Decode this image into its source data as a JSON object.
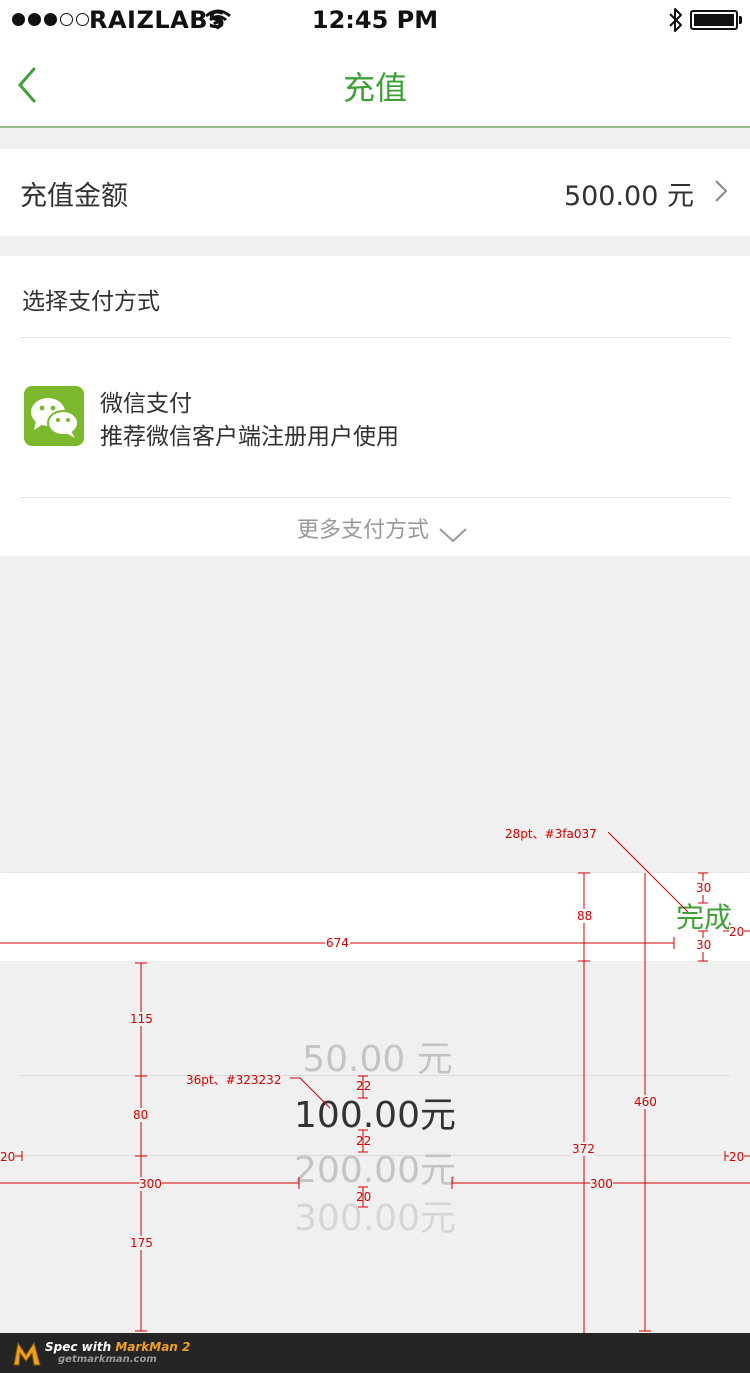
{
  "status_bar": {
    "carrier": "RAIZLABS",
    "time": "12:45 PM"
  },
  "nav": {
    "title": "充值"
  },
  "amount_row": {
    "label": "充值金额",
    "value": "500.00 元"
  },
  "payment": {
    "section_title": "选择支付方式",
    "method_name": "微信支付",
    "method_desc": "推荐微信客户端注册用户使用",
    "more_label": "更多支付方式"
  },
  "picker": {
    "done_label": "完成",
    "options": [
      "50.00 元",
      "100.00元",
      "200.00元",
      "300.00元"
    ],
    "selected": "100.00元"
  },
  "spec_annotations": {
    "done_font": "28pt、#3fa037",
    "option_font": "36pt、#323232",
    "m_toolbar_width": "674",
    "m_toolbar_height": "88",
    "m_done_top": "30",
    "m_done_bottom": "30",
    "m_done_right": "20",
    "m_top_gap": "115",
    "m_row_height": "80",
    "m_bottom_gap": "175",
    "m_gap_1": "22",
    "m_gap_2": "22",
    "m_gap_3": "20",
    "m_picker_height": "372",
    "m_panel_height": "460",
    "m_left_width": "300",
    "m_right_width": "300",
    "m_side_left": "20",
    "m_side_right": "20"
  },
  "footer": {
    "prefix": "Spec with ",
    "brand": "MarkMan 2",
    "url": "getmarkman.com"
  },
  "colors": {
    "accent": "#3fa037",
    "text": "#323232",
    "background": "#f0f0f0",
    "annotation": "#d40000"
  },
  "icons": [
    "wifi-icon",
    "bluetooth-icon",
    "battery-icon",
    "back-arrow-icon",
    "chevron-right-icon",
    "wechat-icon",
    "chevron-down-icon",
    "markman-logo"
  ]
}
